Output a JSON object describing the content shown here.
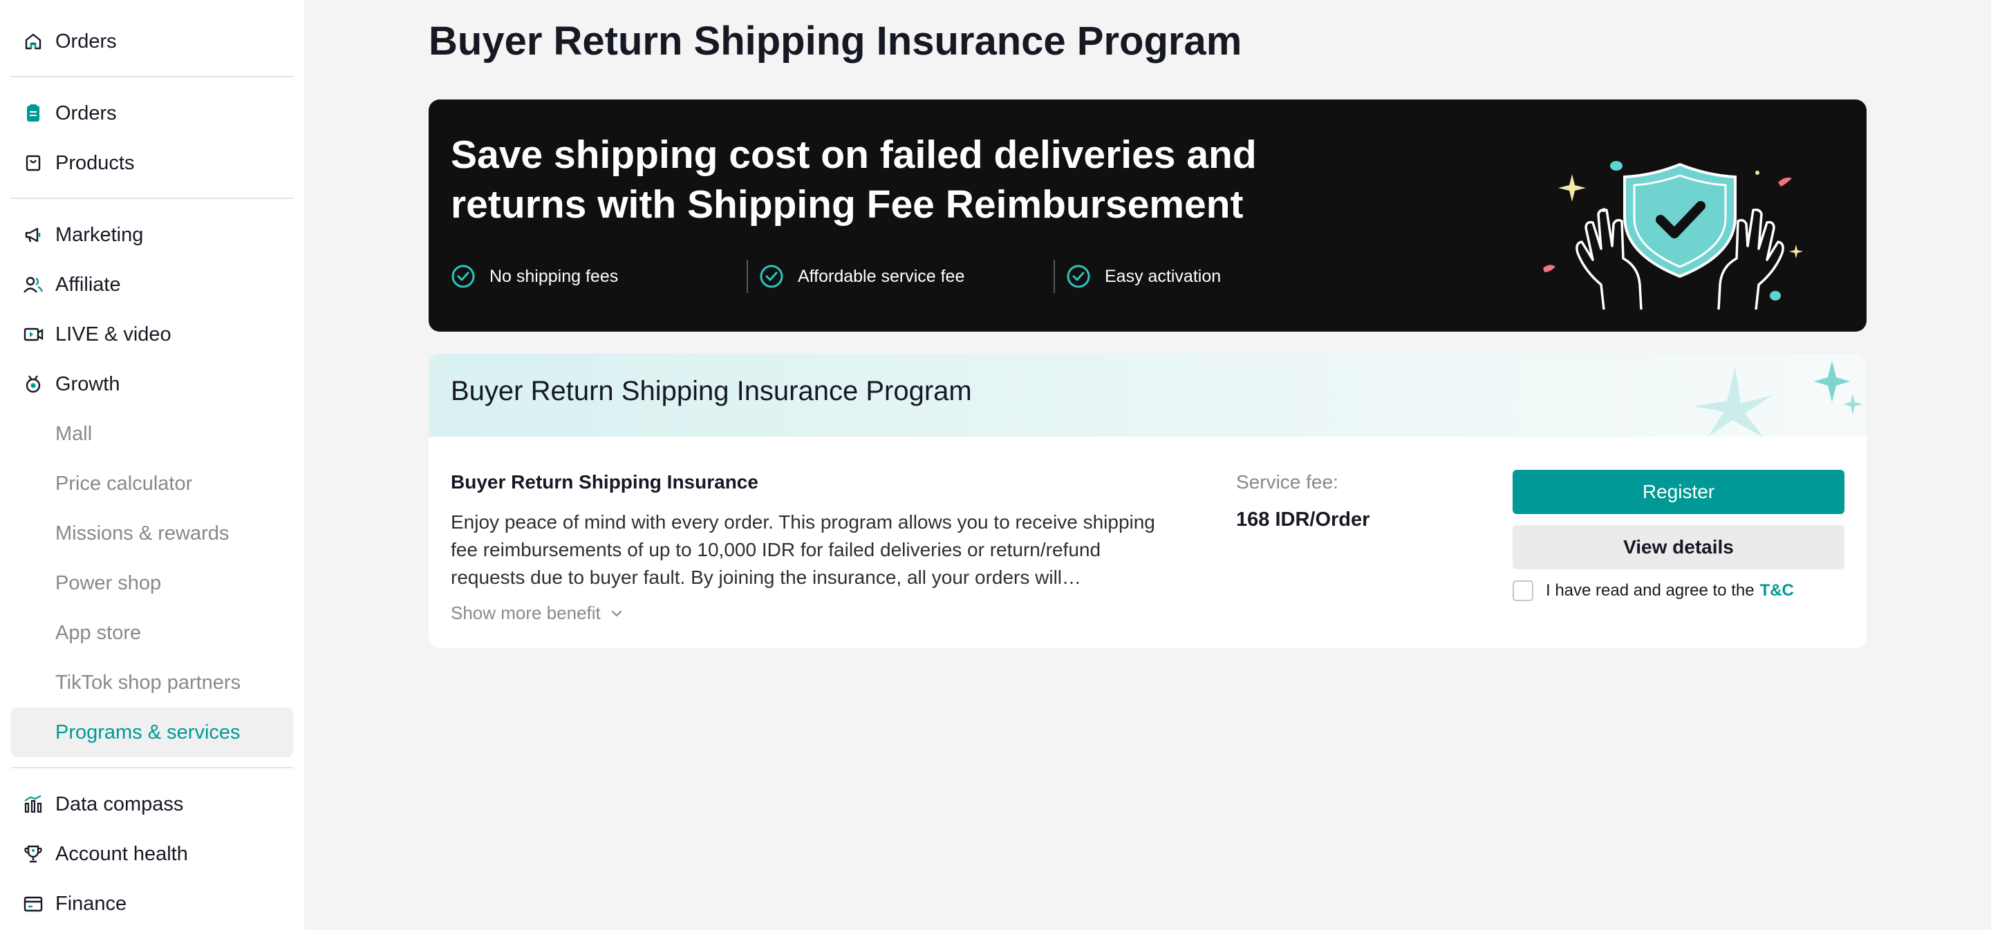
{
  "sidebar": {
    "items": [
      {
        "label": "Orders",
        "icon": "home-icon"
      },
      {
        "label": "Orders",
        "icon": "clipboard-icon"
      },
      {
        "label": "Products",
        "icon": "shopping-bag-icon"
      },
      {
        "label": "Marketing",
        "icon": "megaphone-icon"
      },
      {
        "label": "Affiliate",
        "icon": "people-icon"
      },
      {
        "label": "LIVE & video",
        "icon": "video-icon"
      },
      {
        "label": "Growth",
        "icon": "growth-icon"
      },
      {
        "label": "Mall"
      },
      {
        "label": "Price calculator"
      },
      {
        "label": "Missions & rewards"
      },
      {
        "label": "Power shop"
      },
      {
        "label": "App store"
      },
      {
        "label": "TikTok shop partners"
      },
      {
        "label": "Programs & services",
        "active": true
      },
      {
        "label": "Data compass",
        "icon": "bar-chart-icon"
      },
      {
        "label": "Account health",
        "icon": "trophy-icon"
      },
      {
        "label": "Finance",
        "icon": "wallet-icon"
      }
    ]
  },
  "page": {
    "title": "Buyer Return Shipping Insurance Program"
  },
  "banner": {
    "headline": "Save shipping cost on failed deliveries and returns with Shipping Fee Reimbursement",
    "features": [
      "No shipping fees",
      "Affordable service fee",
      "Easy activation"
    ]
  },
  "program_card": {
    "header_title": "Buyer Return Shipping Insurance Program",
    "insurance_title": "Buyer Return Shipping Insurance",
    "description": "Enjoy peace of mind with every order. This program allows you to receive shipping fee reimbursements of up to 10,000 IDR for failed deliveries or return/refund requests due to buyer fault. By joining the insurance, all your orders will…",
    "show_more": "Show more benefit",
    "service_fee_label": "Service fee:",
    "service_fee_value": "168 IDR/Order",
    "register_label": "Register",
    "view_details_label": "View details",
    "agree_text": "I have read and agree to the",
    "tc_link": "T&C",
    "agree_checked": false
  },
  "colors": {
    "accent": "#009995",
    "banner_bg": "#101010",
    "shield": "#6fd3cf"
  }
}
